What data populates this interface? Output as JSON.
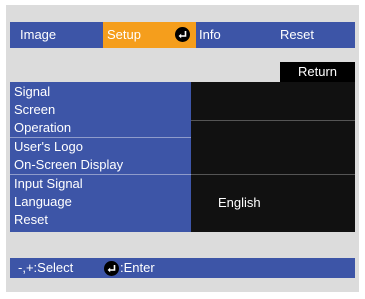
{
  "tabs": [
    {
      "label": "Image",
      "active": false
    },
    {
      "label": "Setup",
      "active": true
    },
    {
      "label": "Info",
      "active": false
    },
    {
      "label": "Reset",
      "active": false
    }
  ],
  "return_label": "Return",
  "menu_items": [
    "Signal",
    "Screen",
    "Operation",
    "User's Logo",
    "On-Screen Display",
    "Input Signal",
    "Language",
    "Reset"
  ],
  "language_value": "English",
  "hints": {
    "select": "-,+:Select",
    "enter": ":Enter"
  },
  "icons": {
    "tab_enter": "enter-icon",
    "hint_enter": "enter-icon"
  },
  "colors": {
    "bar": "#3d55a7",
    "active_tab": "#f59e1c",
    "panel": "#111111",
    "background": "#dcdcdc"
  }
}
